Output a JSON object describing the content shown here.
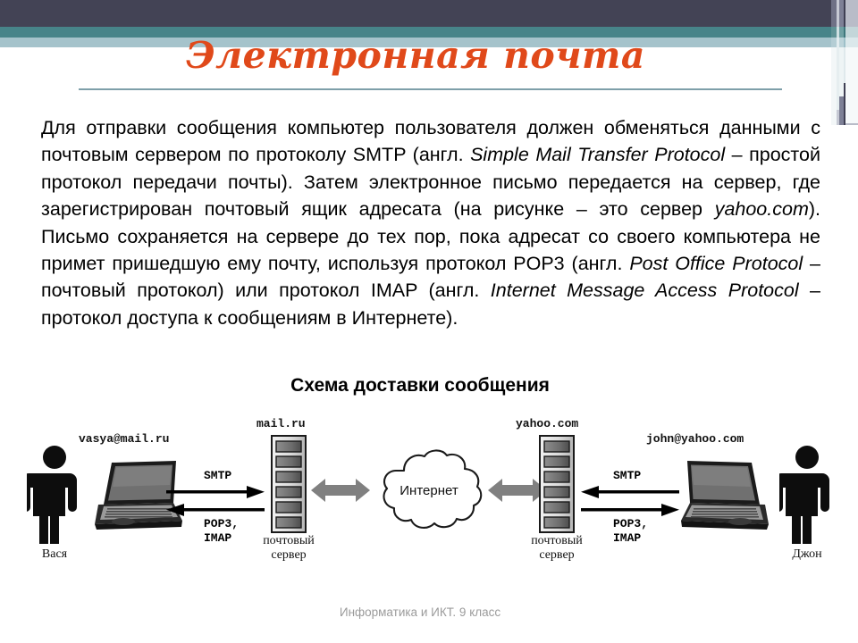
{
  "slide": {
    "title": "Электронная почта",
    "footer": "Информатика и ИКТ. 9 класс",
    "accent_color": "#e0491a",
    "rule_color": "#7e9fa9",
    "band_dark": "#434355",
    "band_teal": "#478489",
    "band_light": "#a5c3cb"
  },
  "body": {
    "p1_a": "Для отправки сообщения компьютер пользователя должен обменяться данными с почтовым сервером по протоколу SMTP (англ. ",
    "p1_it1": "Simple Mail Transfer Protocol",
    "p1_b": " – простой протокол передачи почты). Затем электронное письмо передается на сервер, где зарегистрирован почтовый ящик адресата (на рисунке – это сервер ",
    "p1_it2": "yahoo.com",
    "p1_c": "). Письмо сохраняется на сервере до тех пор, пока адресат  со своего компьютера не примет пришедшую ему почту, используя протокол POP3 (англ. ",
    "p1_it3": "Post Office Protocol",
    "p1_d": " – почтовый протокол) или протокол IMAP (англ. ",
    "p1_it4": "Internet Message Access Protocol",
    "p1_e": " – протокол доступа к сообщениям в Интернете)."
  },
  "diagram": {
    "heading": "Схема доставки сообщения",
    "left_person_name": "Вася",
    "left_email": "vasya@mail.ru",
    "left_server_host": "mail.ru",
    "left_server_caption_line1": "почтовый",
    "left_server_caption_line2": "сервер",
    "left_proto_out": "SMTP",
    "left_proto_in_line1": "POP3,",
    "left_proto_in_line2": "IMAP",
    "cloud_label": "Интернет",
    "right_server_host": "yahoo.com",
    "right_server_caption_line1": "почтовый",
    "right_server_caption_line2": "сервер",
    "right_proto_in": "SMTP",
    "right_proto_out_line1": "POP3,",
    "right_proto_out_line2": "IMAP",
    "right_email": "john@yahoo.com",
    "right_person_name": "Джон",
    "arrow_gray": "#808080",
    "arrow_black": "#000000"
  }
}
